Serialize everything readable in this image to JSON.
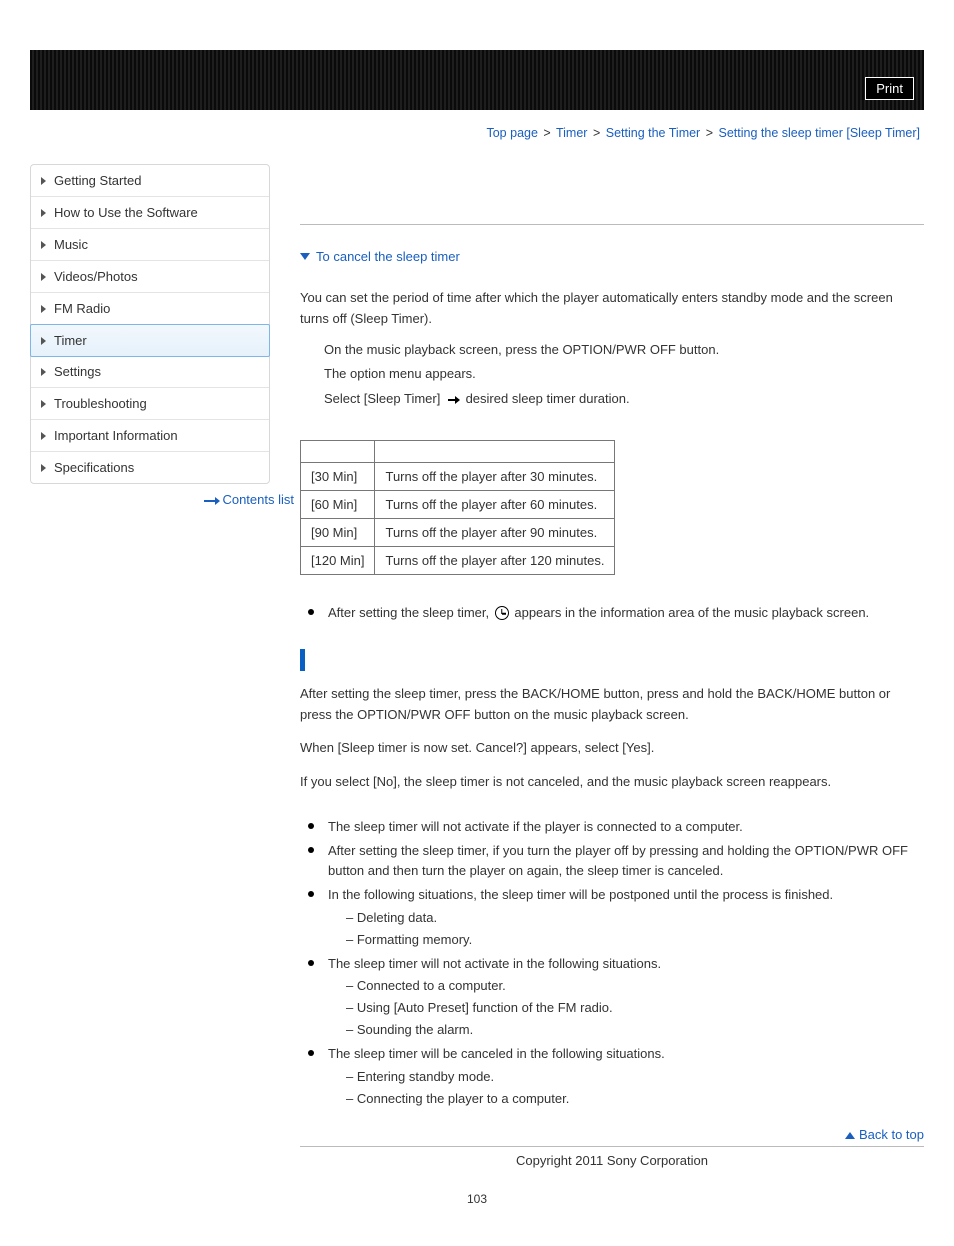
{
  "top": {
    "print_label": "Print"
  },
  "breadcrumb": {
    "items": [
      "Top page",
      "Timer",
      "Setting the Timer",
      "Setting the sleep timer [Sleep Timer]"
    ],
    "sep": ">"
  },
  "sidebar": {
    "items": [
      {
        "label": "Getting Started",
        "active": false
      },
      {
        "label": "How to Use the Software",
        "active": false
      },
      {
        "label": "Music",
        "active": false
      },
      {
        "label": "Videos/Photos",
        "active": false
      },
      {
        "label": "FM Radio",
        "active": false
      },
      {
        "label": "Timer",
        "active": true
      },
      {
        "label": "Settings",
        "active": false
      },
      {
        "label": "Troubleshooting",
        "active": false
      },
      {
        "label": "Important Information",
        "active": false
      },
      {
        "label": "Specifications",
        "active": false
      }
    ],
    "contents_list": "Contents list"
  },
  "content": {
    "anchor_cancel": "To cancel the sleep timer",
    "intro": "You can set the period of time after which the player automatically enters standby mode and the screen turns off (Sleep Timer).",
    "step1a": "On the music playback screen, press the OPTION/PWR OFF button.",
    "step1b": "The option menu appears.",
    "step2_pre": "Select [Sleep Timer] ",
    "step2_post": " desired sleep timer duration.",
    "table": [
      {
        "opt": "[30 Min]",
        "desc": "Turns off the player after 30 minutes."
      },
      {
        "opt": "[60 Min]",
        "desc": "Turns off the player after 60 minutes."
      },
      {
        "opt": "[90 Min]",
        "desc": "Turns off the player after 90 minutes."
      },
      {
        "opt": "[120 Min]",
        "desc": "Turns off the player after 120 minutes."
      }
    ],
    "tip_pre": "After setting the sleep timer, ",
    "tip_post": " appears in the information area of the music playback screen.",
    "cancel_p1": "After setting the sleep timer, press the BACK/HOME button, press and hold the BACK/HOME button or press the OPTION/PWR OFF button on the music playback screen.",
    "cancel_p2": "When [Sleep timer is now set. Cancel?] appears, select [Yes].",
    "cancel_p3": "If you select [No], the sleep timer is not canceled, and the music playback screen reappears.",
    "notes": {
      "n1": "The sleep timer will not activate if the player is connected to a computer.",
      "n2": "After setting the sleep timer, if you turn the player off by pressing and holding the OPTION/PWR OFF button and then turn the player on again, the sleep timer is canceled.",
      "n3": "In the following situations, the sleep timer will be postponed until the process is finished.",
      "n3_sub": [
        "Deleting data.",
        "Formatting memory."
      ],
      "n4": "The sleep timer will not activate in the following situations.",
      "n4_sub": [
        "Connected to a computer.",
        "Using [Auto Preset] function of the FM radio.",
        "Sounding the alarm."
      ],
      "n5": "The sleep timer will be canceled in the following situations.",
      "n5_sub": [
        "Entering standby mode.",
        "Connecting the player to a computer."
      ]
    },
    "back_to_top": "Back to top"
  },
  "footer": {
    "copyright": "Copyright 2011 Sony Corporation",
    "page_num": "103"
  }
}
